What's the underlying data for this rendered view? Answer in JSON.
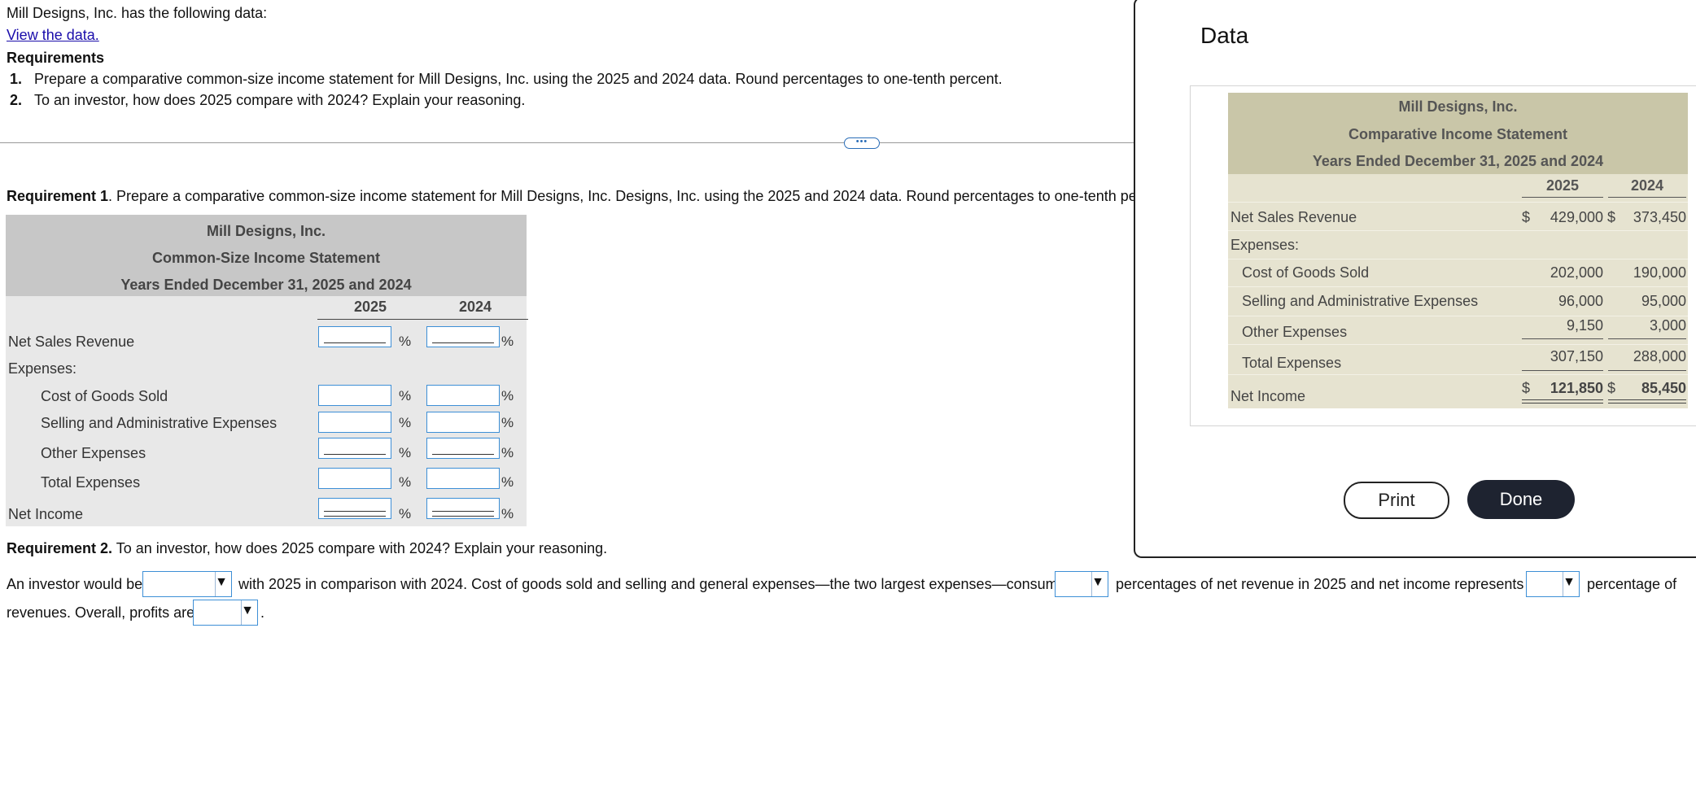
{
  "intro": {
    "statement": "Mill Designs, Inc. has the following data:",
    "view_link": "View the data.",
    "requirements_heading": "Requirements",
    "req1_num": "1.",
    "req1_text": "Prepare a comparative common-size income statement for Mill Designs, Inc. using the 2025 and 2024 data. Round percentages to one-tenth percent.",
    "req2_num": "2.",
    "req2_text": "To an investor, how does 2025 compare with 2024? Explain your reasoning."
  },
  "divider": {
    "collapse_glyph": "•••"
  },
  "requirement1": {
    "label": "Requirement 1",
    "text": ". Prepare a comparative common-size income statement for Mill Designs, Inc. Designs, Inc. using the 2025 and 2024 data. Round percentages to one-tenth percent."
  },
  "worksheet": {
    "company": "Mill Designs, Inc.",
    "title": "Common-Size Income Statement",
    "period": "Years Ended December 31, 2025 and 2024",
    "col_2025": "2025",
    "col_2024": "2024",
    "pct_symbol": "%",
    "rows": {
      "net_sales": "Net Sales Revenue",
      "expenses": "Expenses:",
      "cogs": "Cost of Goods Sold",
      "sga": "Selling and Administrative Expenses",
      "other": "Other Expenses",
      "total": "Total Expenses",
      "net_income": "Net Income"
    }
  },
  "requirement2": {
    "label": "Requirement 2.",
    "text": " To an investor, how does 2025 compare with 2024? Explain your reasoning.",
    "s1": "An investor would be",
    "s2": "with 2025 in comparison with 2024. Cost of goods sold and selling and general expenses—the two largest expenses—consumed",
    "s3": "percentages of net revenue in 2025 and net income represents a",
    "s4": "percentage of",
    "s5": "revenues. Overall, profits are",
    "s6": ".",
    "dropdown_arrow": "▼"
  },
  "data_panel": {
    "title": "Data",
    "company": "Mill Designs, Inc.",
    "statement": "Comparative Income Statement",
    "period": "Years Ended December 31, 2025 and 2024",
    "col_2025": "2025",
    "col_2024": "2024",
    "dollar": "$",
    "rows": {
      "net_sales": {
        "label": "Net Sales Revenue",
        "v2025": "429,000",
        "v2024": "373,450"
      },
      "expenses": {
        "label": "Expenses:"
      },
      "cogs": {
        "label": "Cost of Goods Sold",
        "v2025": "202,000",
        "v2024": "190,000"
      },
      "sga": {
        "label": "Selling and Administrative Expenses",
        "v2025": "96,000",
        "v2024": "95,000"
      },
      "other": {
        "label": "Other Expenses",
        "v2025": "9,150",
        "v2024": "3,000"
      },
      "total": {
        "label": "Total Expenses",
        "v2025": "307,150",
        "v2024": "288,000"
      },
      "net_income": {
        "label": "Net Income",
        "v2025": "121,850",
        "v2024": "85,450"
      }
    },
    "print_label": "Print",
    "done_label": "Done"
  }
}
